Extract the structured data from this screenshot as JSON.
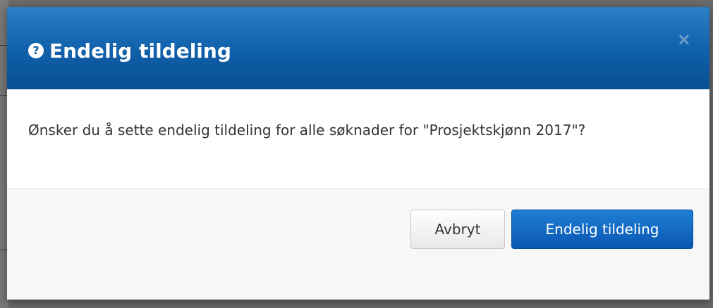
{
  "dialog": {
    "title": "Endelig tildeling",
    "close_symbol": "×",
    "help_symbol": "?",
    "message": "Ønsker du å sette endelig tildeling for alle søknader for \"Prosjektskjønn 2017\"?",
    "buttons": {
      "cancel_label": "Avbryt",
      "confirm_label": "Endelig tildeling"
    }
  },
  "colors": {
    "header_blue": "#0f5fa9",
    "primary_button": "#0a56b3",
    "backdrop": "#6b6b6b"
  },
  "icons": {
    "help": "question-circle-icon",
    "close": "close-icon"
  }
}
